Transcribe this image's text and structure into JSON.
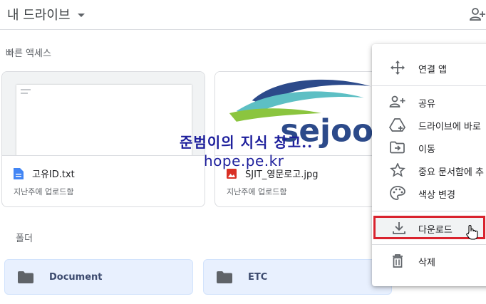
{
  "header": {
    "title": "내 드라이브"
  },
  "quick_access": {
    "label": "빠른 액세스",
    "files": [
      {
        "name": "고유ID.txt",
        "subtitle": "지난주에 업로드함",
        "type": "document"
      },
      {
        "name": "SJIT_영문로고.jpg",
        "subtitle": "지난주에 업로드함",
        "type": "image",
        "thumb_text": "sejoon"
      }
    ]
  },
  "folders": {
    "label": "폴더",
    "items": [
      {
        "name": "Document"
      },
      {
        "name": "ETC"
      }
    ]
  },
  "watermark": {
    "line1": "준범이의 지식 창고..",
    "line2": "hope.pe.kr"
  },
  "context_menu": {
    "items": [
      {
        "label": "연결 앱",
        "icon": "move-arrows-icon"
      },
      {
        "label": "공유",
        "icon": "person-add-icon"
      },
      {
        "label": "드라이브에 바로",
        "icon": "drive-add-icon"
      },
      {
        "label": "이동",
        "icon": "folder-move-icon"
      },
      {
        "label": "중요 문서함에 추",
        "icon": "star-icon"
      },
      {
        "label": "색상 변경",
        "icon": "palette-icon"
      },
      {
        "label": "다운로드",
        "icon": "download-icon"
      },
      {
        "label": "삭제",
        "icon": "trash-icon"
      }
    ]
  },
  "colors": {
    "accent_red": "#d9232e",
    "folder_bg": "#e8f0fe",
    "doc_blue": "#4285f4",
    "image_red": "#d93025"
  }
}
